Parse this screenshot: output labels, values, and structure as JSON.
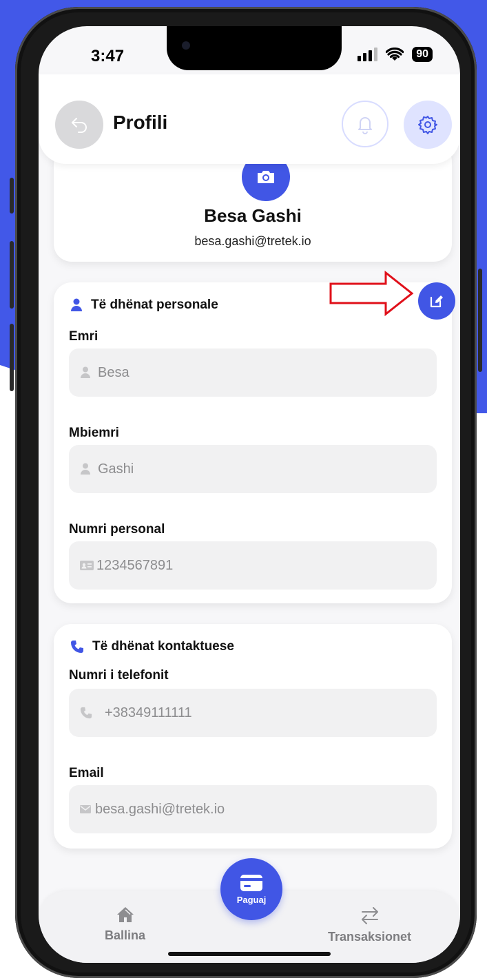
{
  "status_bar": {
    "time": "3:47",
    "battery": "90"
  },
  "header": {
    "title": "Profili"
  },
  "profile": {
    "name": "Besa Gashi",
    "email": "besa.gashi@tretek.io"
  },
  "personal_section": {
    "title": "Të dhënat personale",
    "fields": [
      {
        "label": "Emri",
        "value": "Besa",
        "icon": "user-icon"
      },
      {
        "label": "Mbiemri",
        "value": "Gashi",
        "icon": "user-icon"
      },
      {
        "label": "Numri personal",
        "value": "1234567891",
        "icon": "id-card-icon"
      }
    ]
  },
  "contact_section": {
    "title": "Të dhënat kontaktuese",
    "fields": [
      {
        "label": "Numri i telefonit",
        "value": "+38349111111",
        "icon": "phone-icon"
      },
      {
        "label": "Email",
        "value": "besa.gashi@tretek.io",
        "icon": "mail-icon"
      }
    ]
  },
  "bottom_nav": {
    "home": "Ballina",
    "pay": "Paguaj",
    "transactions": "Transaksionet"
  },
  "colors": {
    "accent": "#4156e5",
    "annotation": "#e0101a",
    "background_shape": "#4258e8"
  }
}
